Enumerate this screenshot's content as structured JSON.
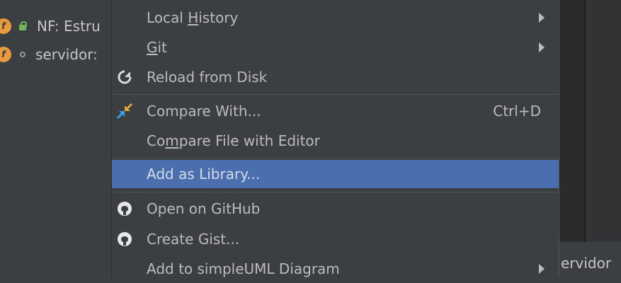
{
  "tree": {
    "rows": [
      {
        "badge": "f",
        "label": "NF: Estru"
      },
      {
        "badge": "f",
        "label": "servidor:"
      }
    ]
  },
  "menu": {
    "items": [
      {
        "label_parts": [
          "Local ",
          "H",
          "istory"
        ],
        "submenu": true
      },
      {
        "label_parts": [
          "",
          "G",
          "it"
        ],
        "submenu": true
      },
      {
        "label": "Reload from Disk",
        "icon": "reload-icon"
      },
      {
        "label": "Compare With...",
        "shortcut": "Ctrl+D",
        "icon": "compare-icon"
      },
      {
        "label_parts": [
          "Co",
          "m",
          "pare File with Editor"
        ]
      },
      {
        "label": "Add as Library...",
        "selected": true
      },
      {
        "label": "Open on GitHub",
        "icon": "github-icon"
      },
      {
        "label": "Create Gist...",
        "icon": "github-icon"
      },
      {
        "label": "Add to simpleUML Diagram",
        "submenu": true
      }
    ]
  },
  "editor": {
    "bottom_label": "ervidor"
  },
  "colors": {
    "background": "#3c3f41",
    "selection": "#4b6eaf",
    "editor": "#2b2b2b",
    "badge": "#e89a3c"
  }
}
